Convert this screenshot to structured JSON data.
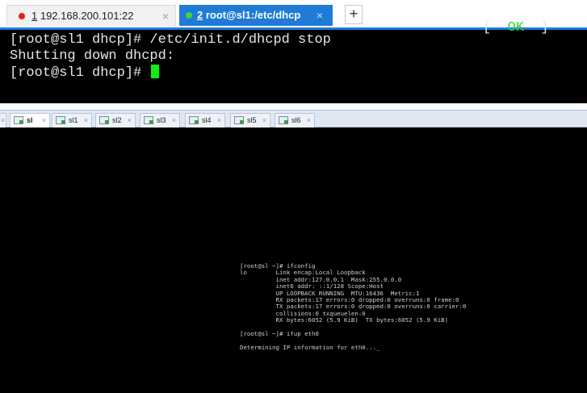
{
  "ssh_client": {
    "tabs": [
      {
        "number": "1",
        "title": " 192.168.200.101:22",
        "close": "×"
      },
      {
        "number": "2",
        "title": " root@sl1:/etc/dhcp",
        "close": "×"
      }
    ],
    "new_tab_label": "+",
    "terminal": {
      "lines": [
        "[root@sl1 dhcp]# /etc/init.d/dhcpd stop",
        "Shutting down dhcpd:",
        "[root@sl1 dhcp]# "
      ],
      "status_open": "[  ",
      "status_ok": "OK",
      "status_close": "  ]"
    },
    "colors": {
      "active_tab": "#1f7bd6",
      "ok": "#2fcf2f",
      "cursor": "#12ee12",
      "tab1_dot": "#e0201b",
      "tab2_dot": "#3fd43f"
    }
  },
  "vm_console": {
    "edge_close": "×",
    "tabs": [
      {
        "label": "sl",
        "close": "×",
        "active": true
      },
      {
        "label": "sl1",
        "close": "×"
      },
      {
        "label": "sl2",
        "close": "×"
      },
      {
        "label": "sl3",
        "close": "×"
      },
      {
        "label": "sl4",
        "close": "×"
      },
      {
        "label": "sl5",
        "close": "×"
      },
      {
        "label": "sl6",
        "close": "×"
      }
    ],
    "screen_lines_block1": [
      "[root@sl ~]# ifconfig",
      "lo        Link encap:Local Loopback",
      "          inet addr:127.0.0.1  Mask:255.0.0.0",
      "          inet6 addr: ::1/128 Scope:Host",
      "          UP LOOPBACK RUNNING  MTU:16436  Metric:1",
      "          RX packets:17 errors:0 dropped:0 overruns:0 frame:0",
      "          TX packets:17 errors:0 dropped:0 overruns:0 carrier:0",
      "          collisions:0 txqueuelen:0",
      "          RX bytes:6052 (5.9 KiB)  TX bytes:6052 (5.9 KiB)"
    ],
    "screen_lines_block2": [
      "[root@sl ~]# ifup eth0"
    ],
    "screen_lines_block3": [
      "Determining IP information for eth0..._"
    ]
  }
}
